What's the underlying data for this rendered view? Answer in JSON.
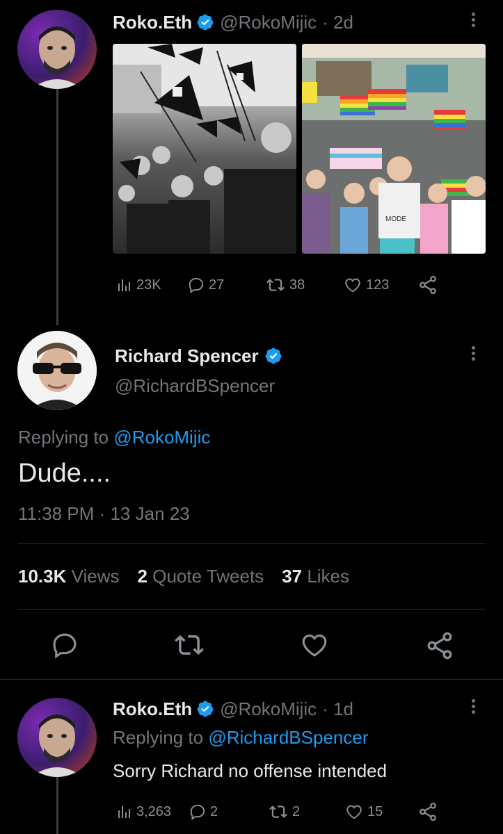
{
  "tweet1": {
    "author_name": "Roko.Eth",
    "handle": "@RokoMijic",
    "time": "· 2d",
    "stats": {
      "views": "23K",
      "replies": "27",
      "retweets": "38",
      "likes": "123"
    }
  },
  "tweet2": {
    "author_name": "Richard Spencer",
    "handle": "@RichardBSpencer",
    "replying_prefix": "Replying to",
    "replying_to": "@RokoMijic",
    "body": "Dude....",
    "timestamp": "11:38 PM · 13 Jan 23",
    "views_count": "10.3K",
    "views_label": "Views",
    "quotes_count": "2",
    "quotes_label": "Quote Tweets",
    "likes_count": "37",
    "likes_label": "Likes"
  },
  "tweet3": {
    "author_name": "Roko.Eth",
    "handle": "@RokoMijic",
    "time": "· 1d",
    "replying_prefix": "Replying to",
    "replying_to": "@RichardBSpencer",
    "body": "Sorry Richard no offense intended",
    "stats": {
      "views": "3,263",
      "replies": "2",
      "retweets": "2",
      "likes": "15"
    }
  },
  "image_right_sign": "MODE",
  "colors": {
    "background": "#000000",
    "text": "#e7e9ea",
    "muted": "#71767b",
    "accent": "#1d9bf0",
    "divider": "#2f3336"
  }
}
